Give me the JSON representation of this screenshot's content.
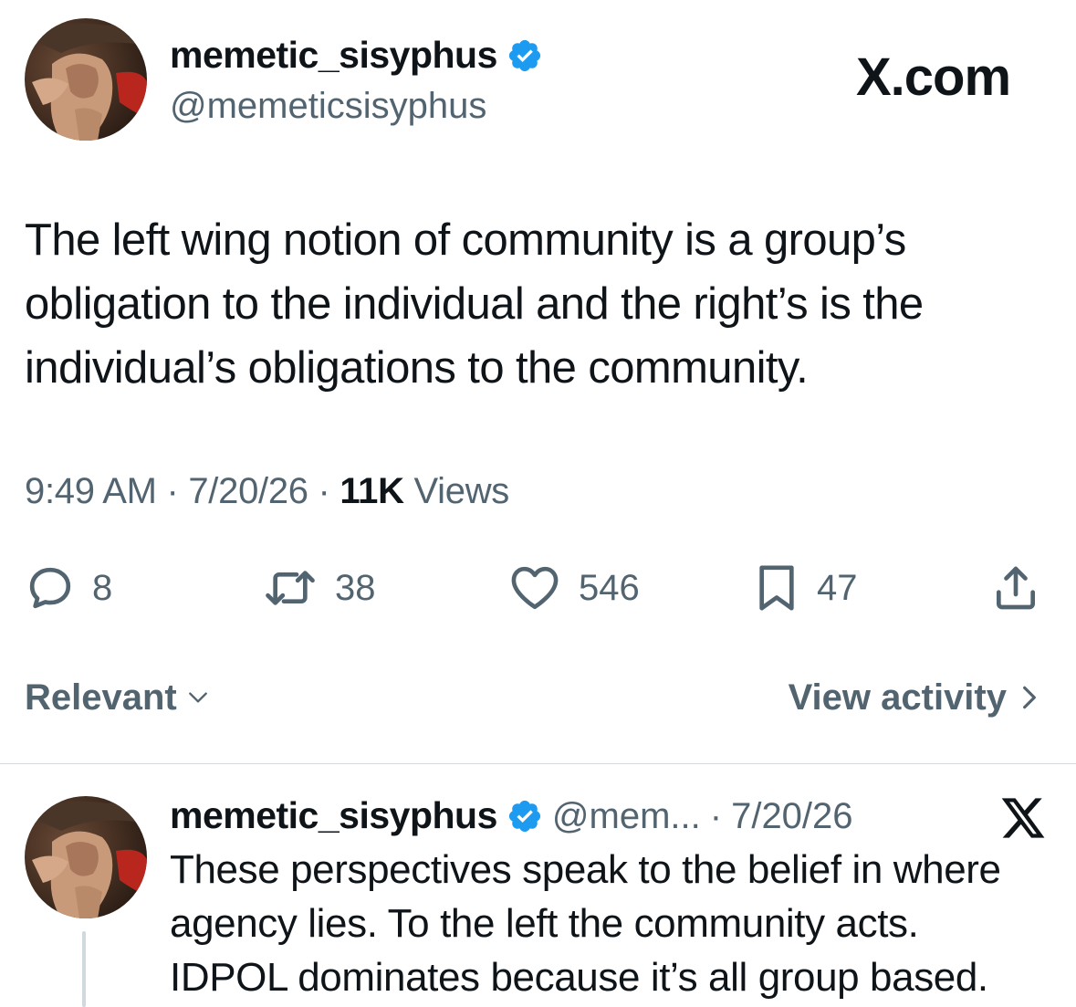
{
  "brand": {
    "label": "X.com"
  },
  "tweet": {
    "author": {
      "display_name": "memetic_sisyphus",
      "handle": "@memeticsisyphus",
      "verified": true
    },
    "text_lines": [
      "The left wing notion of community is a group’s",
      "obligation to the individual and the right’s is the",
      "individual’s obligations to the community."
    ],
    "meta": {
      "time": "9:49 AM",
      "sep1": "·",
      "date": "7/20/26",
      "sep2": "·",
      "views_count": "11K",
      "views_label": "Views"
    },
    "actions": {
      "replies": "8",
      "reposts": "38",
      "likes": "546",
      "bookmarks": "47"
    }
  },
  "filters": {
    "sort_label": "Relevant",
    "view_activity_label": "View activity"
  },
  "reply": {
    "author": {
      "display_name": "memetic_sisyphus",
      "handle_truncated": "@mem...",
      "sep": "·",
      "date": "7/20/26",
      "verified": true
    },
    "text_lines": [
      "These perspectives speak to the belief in where",
      "agency lies. To the left the community acts.",
      "IDPOL dominates because it’s all group based."
    ]
  },
  "colors": {
    "text_primary": "#0f1419",
    "text_secondary": "#536471",
    "verified_blue": "#1d9bf0",
    "divider": "#d6dbdf"
  },
  "icons": {
    "reply": "speech-bubble-icon",
    "repost": "repost-arrows-icon",
    "like": "heart-icon",
    "bookmark": "bookmark-icon",
    "share": "share-upload-icon",
    "verified": "verified-badge-icon",
    "brand": "x-logo-icon"
  }
}
